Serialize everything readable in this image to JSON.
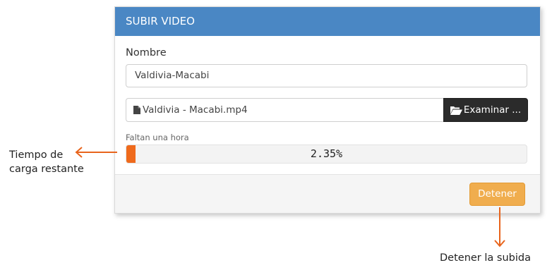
{
  "panel": {
    "title": "SUBIR VIDEO",
    "name_label": "Nombre",
    "name_value": "Valdivia-Macabi",
    "file_name": "Valdivia - Macabi.mp4",
    "browse_label": "Examinar ...",
    "time_remaining": "Faltan una hora",
    "progress_text": "2.35%",
    "progress_fraction": 0.0235,
    "stop_label": "Detener"
  },
  "annotations": {
    "remaining_time": [
      "Tiempo de",
      "carga restante"
    ],
    "stop_upload": "Detener la subida"
  },
  "colors": {
    "header": "#4a87c4",
    "progress_fill": "#ef6a1c",
    "stop_button": "#f0ad4e",
    "browse_button": "#2b2b2b",
    "arrow": "#e8641c"
  },
  "icons": {
    "file": "file-icon",
    "folder": "folder-open-icon"
  }
}
